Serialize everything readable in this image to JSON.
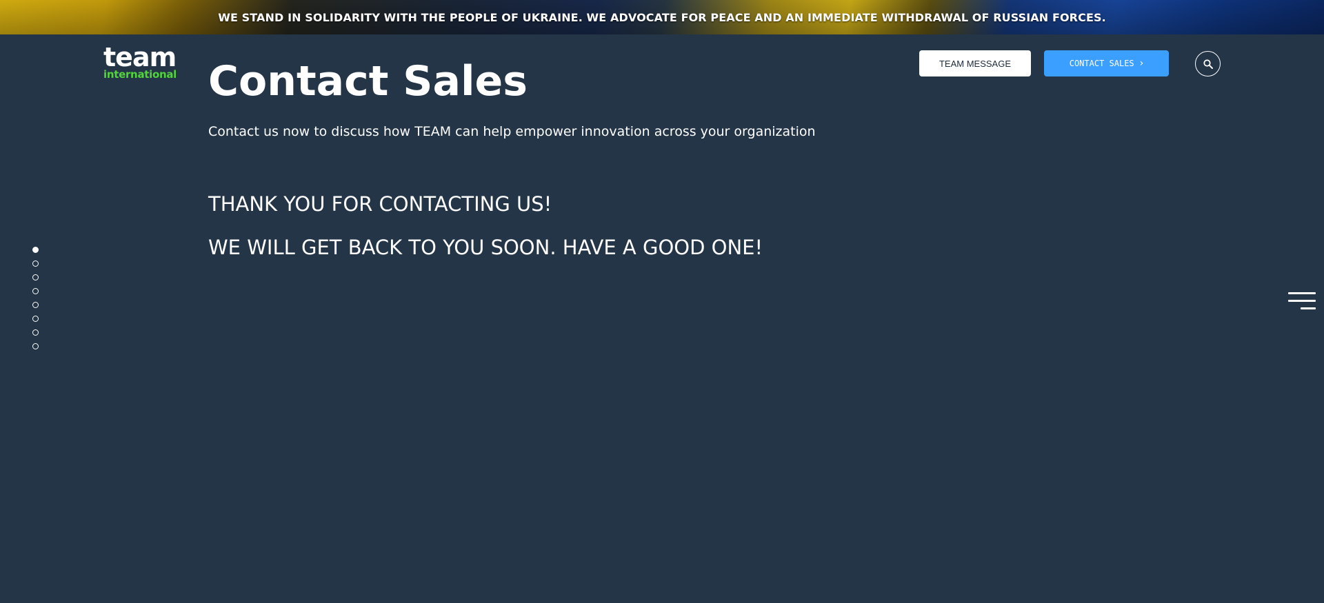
{
  "banner": {
    "text": "WE STAND IN SOLIDARITY WITH THE PEOPLE OF UKRAINE. WE ADVOCATE FOR PEACE AND AN IMMEDIATE WITHDRAWAL OF RUSSIAN FORCES."
  },
  "logo": {
    "top": "team",
    "bottom": "international"
  },
  "header": {
    "team_message_label": "TEAM MESSAGE",
    "contact_sales_label": "CONTACT SALES",
    "contact_sales_chevron": "›",
    "search_icon": "search-icon"
  },
  "main": {
    "title": "Contact Sales",
    "subtitle": "Contact us now to discuss how TEAM can help empower innovation across your organization",
    "thanks_line_1": "THANK YOU FOR CONTACTING US!",
    "thanks_line_2": "WE WILL GET BACK TO YOU SOON. HAVE A GOOD ONE!"
  },
  "pagination": {
    "count": 8,
    "active_index": 0
  },
  "menu": {
    "icon": "hamburger-menu-icon"
  },
  "colors": {
    "background": "#243547",
    "accent_blue": "#3a9fff",
    "logo_green": "#52d43b"
  }
}
